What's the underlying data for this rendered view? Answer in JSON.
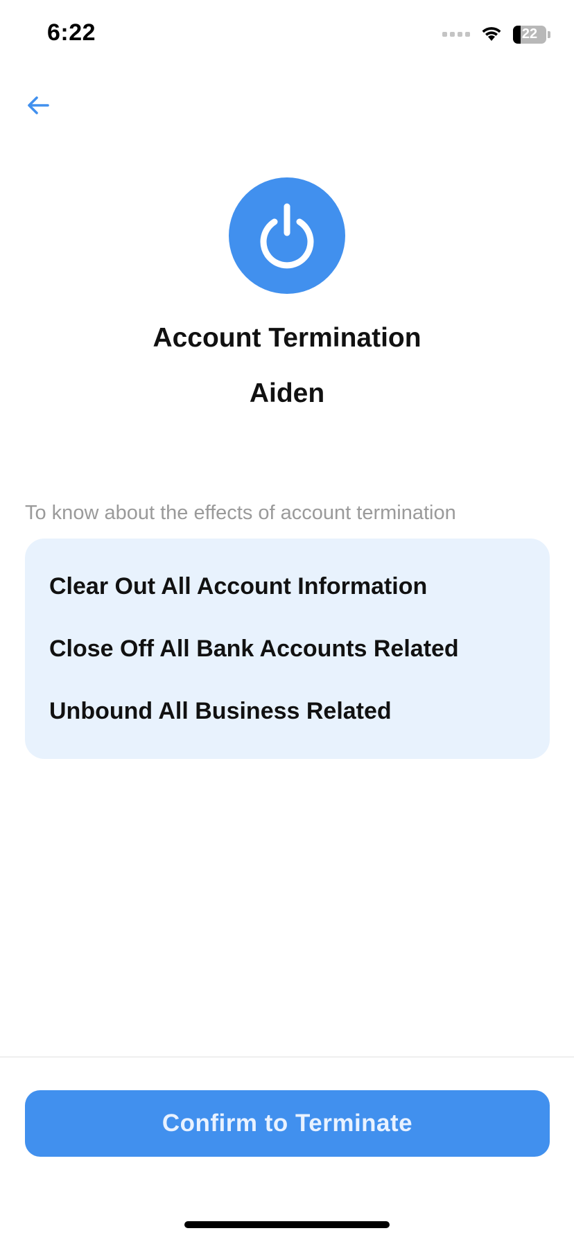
{
  "status_bar": {
    "time": "6:22",
    "battery_level": "22",
    "battery_fraction": 0.22
  },
  "nav": {
    "back_icon": "arrow-left-icon"
  },
  "hero": {
    "icon": "power-icon",
    "icon_color": "#4190ee",
    "title": "Account Termination",
    "username": "Aiden"
  },
  "effects": {
    "label": "To know about the effects of account termination",
    "items": [
      "Clear Out All Account Information",
      "Close Off All Bank Accounts Related",
      "Unbound All Business Related"
    ],
    "card_color": "#e8f2fd"
  },
  "footer": {
    "confirm_label": "Confirm to Terminate",
    "button_color": "#4190ee"
  }
}
